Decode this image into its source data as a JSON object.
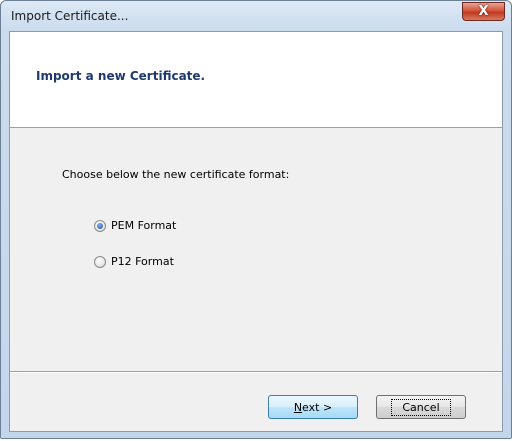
{
  "window": {
    "title": "Import Certificate...",
    "close_glyph": "X"
  },
  "header": {
    "title": "Import a new Certificate."
  },
  "body": {
    "prompt": "Choose below the new certificate format:",
    "options": [
      {
        "label": "PEM Format",
        "checked": true
      },
      {
        "label": "P12 Format",
        "checked": false
      }
    ]
  },
  "footer": {
    "next_mnemonic": "N",
    "next_rest": "ext >",
    "cancel_label": "Cancel"
  },
  "icons": {
    "close": "close-icon"
  },
  "colors": {
    "header_title": "#1f3a6e",
    "close_button": "#c0391f"
  }
}
